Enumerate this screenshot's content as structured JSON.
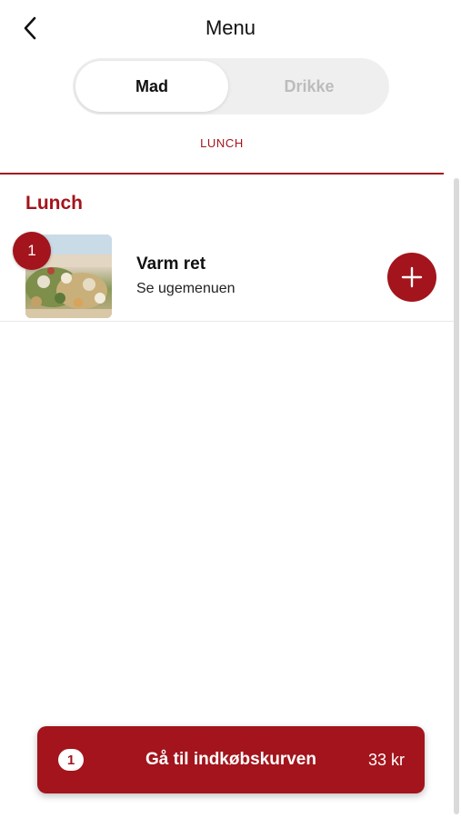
{
  "header": {
    "title": "Menu"
  },
  "segments": [
    {
      "label": "Mad",
      "active": true
    },
    {
      "label": "Drikke",
      "active": false
    }
  ],
  "category_tab": {
    "label": "LUNCH"
  },
  "section": {
    "title": "Lunch"
  },
  "items": [
    {
      "name": "Varm ret",
      "description": "Se ugemenuen",
      "quantity": "1",
      "image_icon": "food-photo"
    }
  ],
  "cart": {
    "count": "1",
    "label": "Gå til indkøbskurven",
    "total": "33 kr"
  },
  "colors": {
    "accent": "#a3141c",
    "segment_bg": "#efefef",
    "inactive_text": "#bcbcbc"
  }
}
